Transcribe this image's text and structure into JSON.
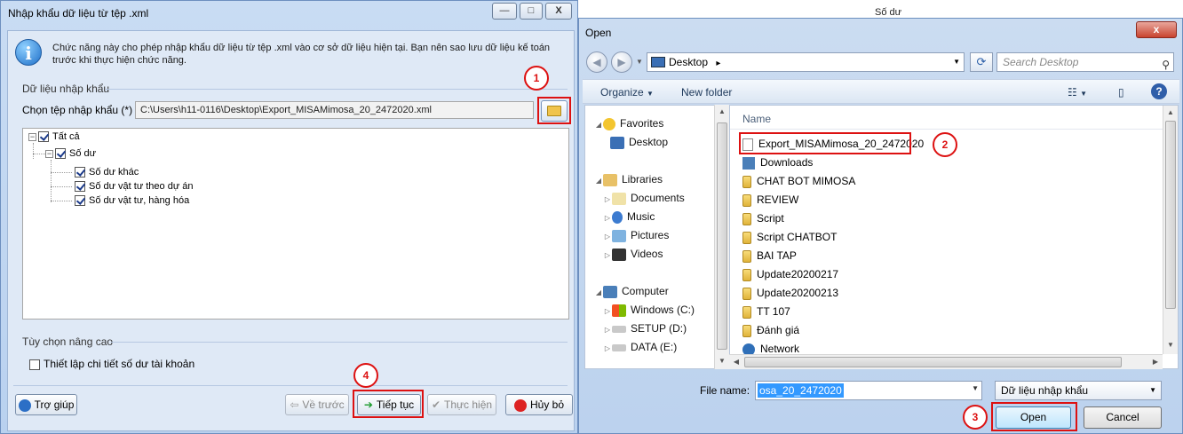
{
  "background": {
    "right_header": "Số dư"
  },
  "import_dialog": {
    "title": "Nhập khẩu dữ liệu từ tệp .xml",
    "window_controls": {
      "minimize": "—",
      "maximize": "□",
      "close": "X"
    },
    "info_text": "Chức năng này cho phép nhập khẩu dữ liệu từ tệp .xml vào cơ sở dữ liệu hiện tại. Bạn nên sao lưu dữ liệu kế toán trước khi thực hiện chức năng.",
    "import_data_section": "Dữ liệu nhập khẩu",
    "choose_file_label": "Chọn tệp nhập khẩu (*)",
    "file_path": "C:\\Users\\h11-0116\\Desktop\\Export_MISAMimosa_20_2472020.xml",
    "tree": {
      "root": "Tất cả",
      "group": "Số dư",
      "children": [
        "Số dư khác",
        "Số dư vật tư theo dự án",
        "Số dư vật tư, hàng hóa"
      ]
    },
    "advanced_section": "Tùy chọn nâng cao",
    "advanced_option": "Thiết lập chi tiết số dư tài khoản",
    "buttons": {
      "help": "Trợ giúp",
      "back": "Về trước",
      "next": "Tiếp tục",
      "execute": "Thực hiện",
      "cancel": "Hủy bỏ"
    }
  },
  "open_dialog": {
    "title": "Open",
    "close": "x",
    "address": "Desktop",
    "address_sep": "▸",
    "search_placeholder": "Search Desktop",
    "toolbar": {
      "organize": "Organize",
      "new_folder": "New folder"
    },
    "nav": {
      "favorites": "Favorites",
      "desktop": "Desktop",
      "libraries": "Libraries",
      "documents": "Documents",
      "music": "Music",
      "pictures": "Pictures",
      "videos": "Videos",
      "computer": "Computer",
      "drive_c": "Windows (C:)",
      "drive_d": "SETUP (D:)",
      "drive_e": "DATA (E:)"
    },
    "column_name": "Name",
    "files": [
      "Export_MISAMimosa_20_2472020",
      "Downloads",
      "CHAT BOT MIMOSA",
      "REVIEW",
      "Script",
      "Script CHATBOT",
      "BAI TAP",
      "Update20200217",
      "Update20200213",
      "TT 107",
      "Đánh giá",
      "Network"
    ],
    "file_name_label": "File name:",
    "file_name_value": "osa_20_2472020",
    "file_type": "Dữ liệu nhập khẩu",
    "buttons": {
      "open": "Open",
      "cancel": "Cancel"
    }
  },
  "callouts": [
    "1",
    "2",
    "3",
    "4"
  ],
  "colors": {
    "callout_red": "#dd1111",
    "dialog_blue": "#c9dcf3",
    "selection": "#3399ff"
  }
}
